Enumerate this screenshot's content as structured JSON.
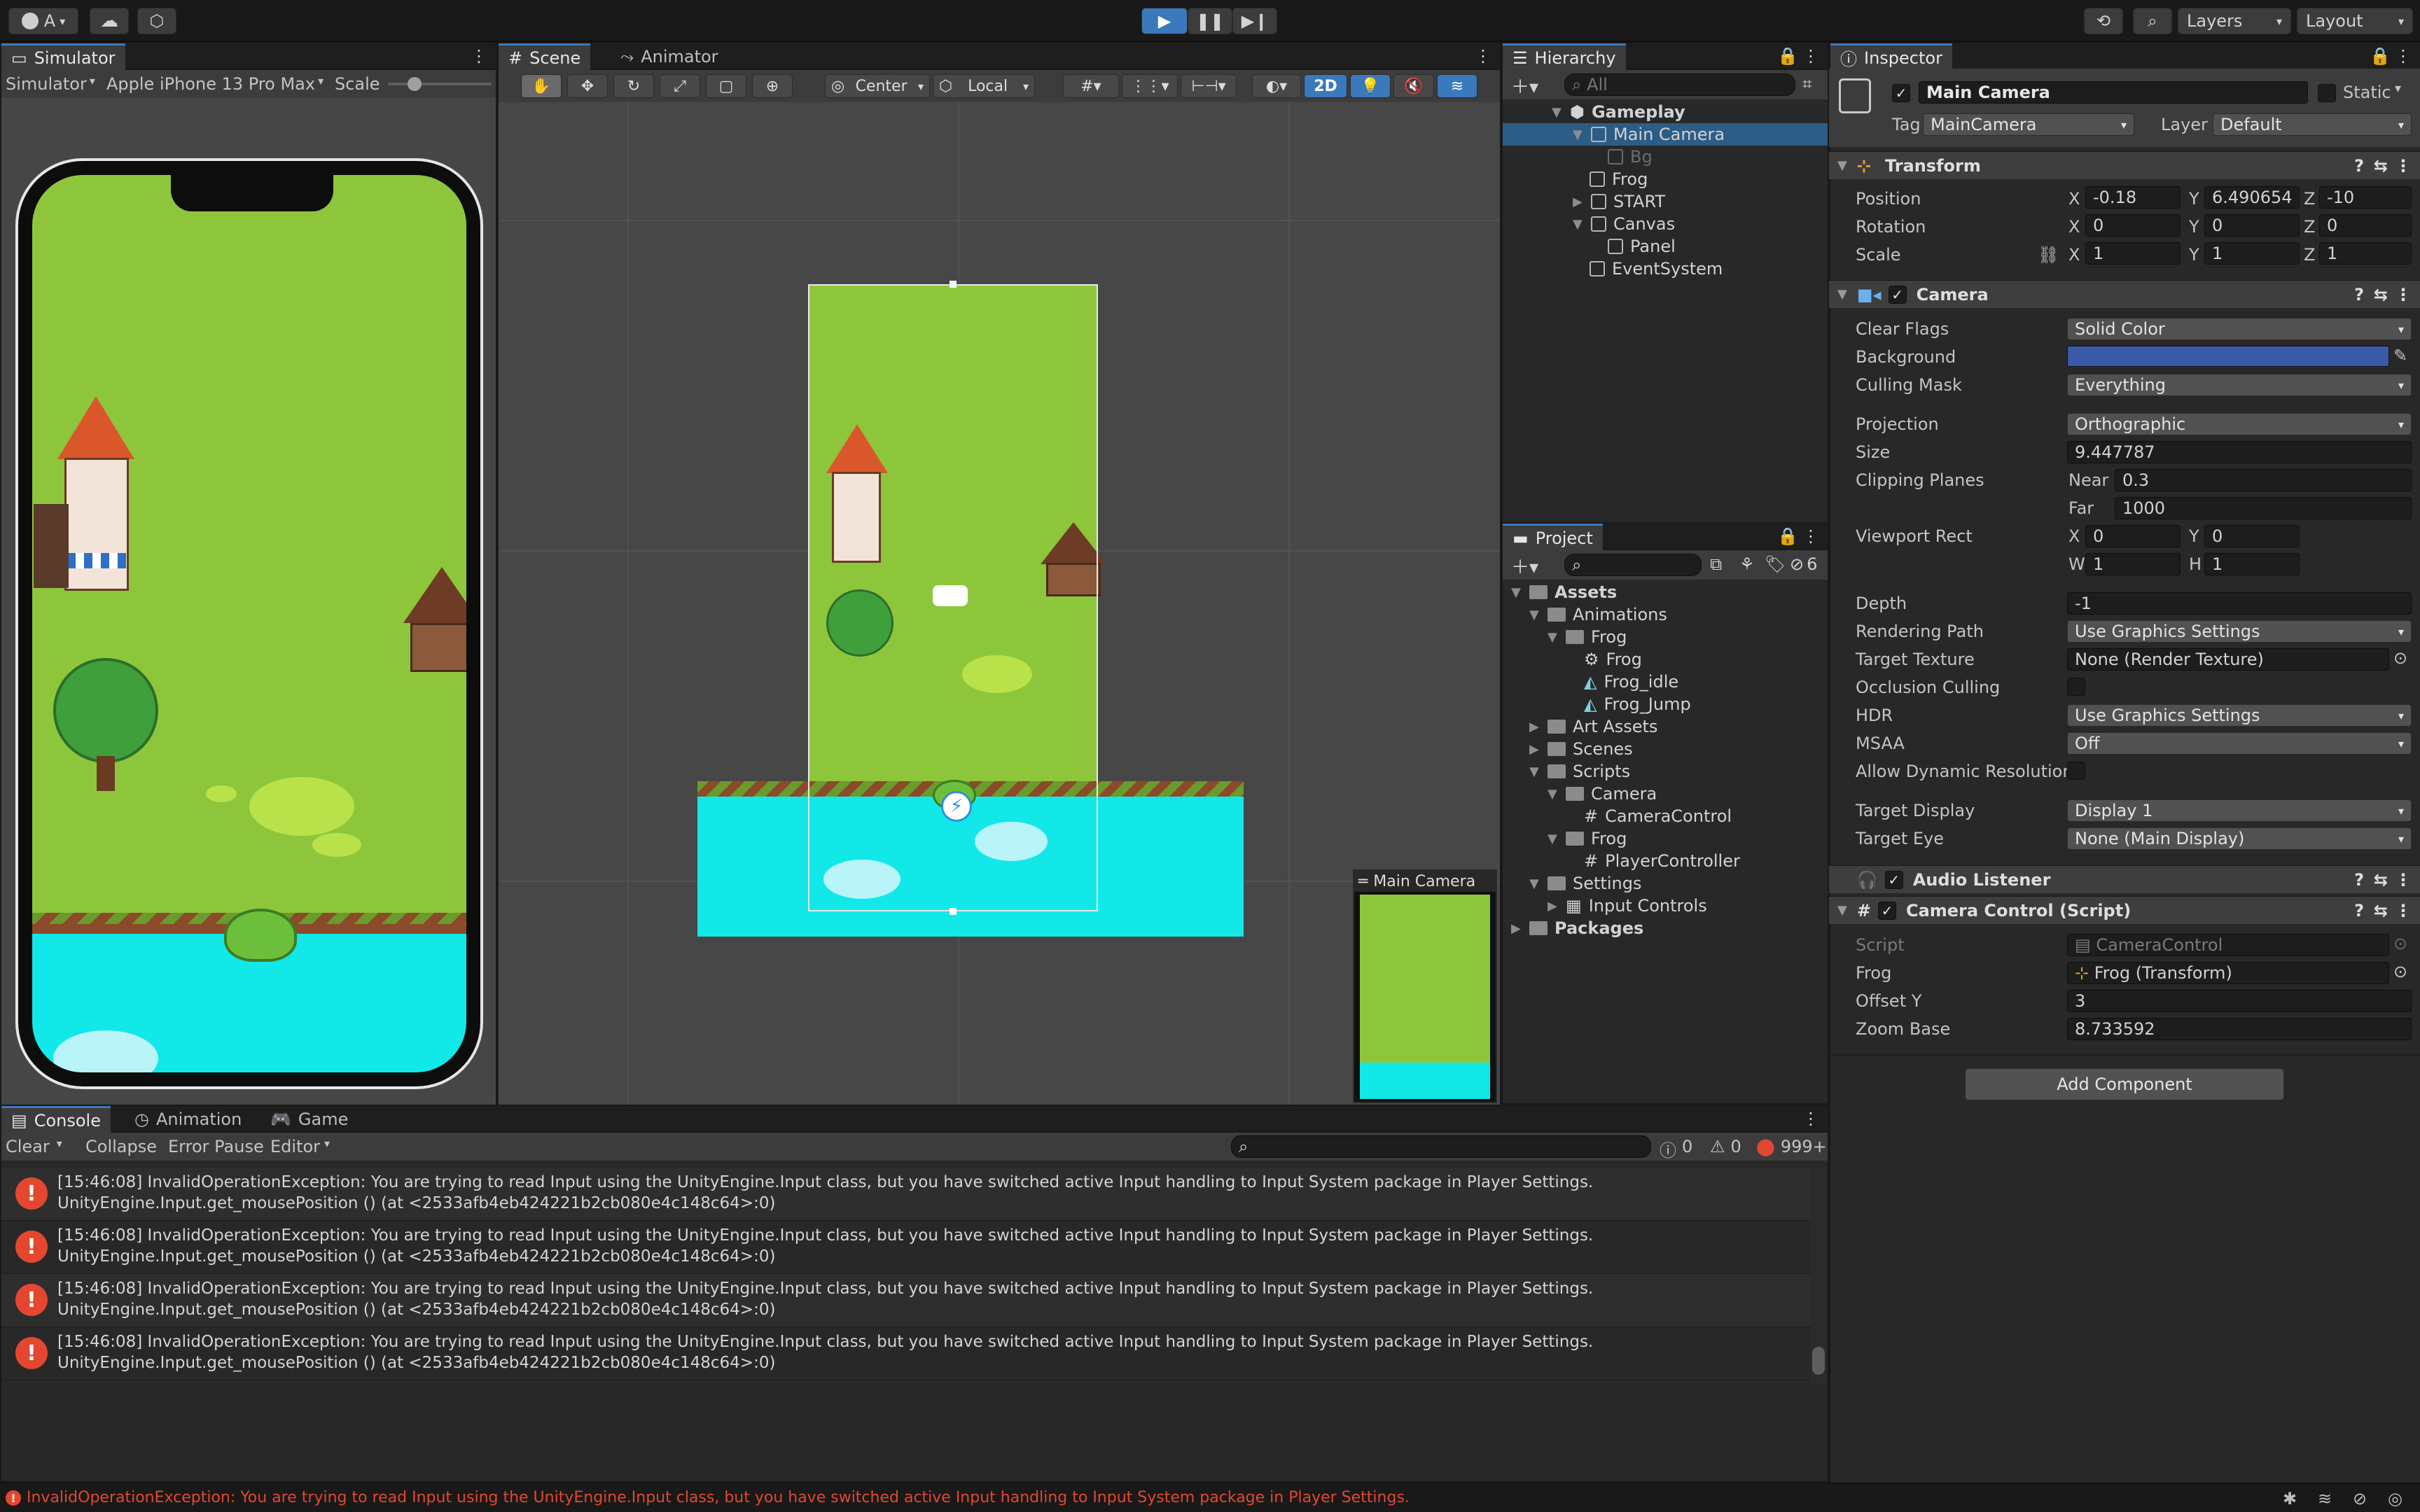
{
  "topbar": {
    "account": "A",
    "layers": "Layers",
    "layout": "Layout"
  },
  "simulator": {
    "tab": "Simulator",
    "mode": "Simulator",
    "device": "Apple iPhone 13 Pro Max",
    "scale_label": "Scale"
  },
  "scene_tabs": {
    "scene": "Scene",
    "animator": "Animator"
  },
  "scene_toolbar": {
    "pivot": "Center",
    "space": "Local",
    "two_d": "2D"
  },
  "camera_preview_title": "Main Camera",
  "hierarchy": {
    "tab": "Hierarchy",
    "search_placeholder": "All",
    "items": [
      "Gameplay",
      "Main Camera",
      "Bg",
      "Frog",
      "START",
      "Canvas",
      "Panel",
      "EventSystem"
    ]
  },
  "project": {
    "tab": "Project",
    "hidden_count": "6",
    "items": [
      "Assets",
      "Animations",
      "Frog",
      "Frog",
      "Frog_idle",
      "Frog_Jump",
      "Art Assets",
      "Scenes",
      "Scripts",
      "Camera",
      "CameraControl",
      "Frog",
      "PlayerController",
      "Settings",
      "Input Controls",
      "Packages"
    ]
  },
  "inspector": {
    "tab": "Inspector",
    "object_name": "Main Camera",
    "static_label": "Static",
    "tag_label": "Tag",
    "tag_value": "MainCamera",
    "layer_label": "Layer",
    "layer_value": "Default",
    "transform": {
      "title": "Transform",
      "position_label": "Position",
      "pos_x": "-0.18",
      "pos_y": "6.490654",
      "pos_z": "-10",
      "rotation_label": "Rotation",
      "rot_x": "0",
      "rot_y": "0",
      "rot_z": "0",
      "scale_label": "Scale",
      "scale_x": "1",
      "scale_y": "1",
      "scale_z": "1"
    },
    "camera": {
      "title": "Camera",
      "clear_flags_label": "Clear Flags",
      "clear_flags": "Solid Color",
      "background_label": "Background",
      "background_color": "#3a5aa8",
      "culling_mask_label": "Culling Mask",
      "culling_mask": "Everything",
      "projection_label": "Projection",
      "projection": "Orthographic",
      "size_label": "Size",
      "size": "9.447787",
      "clipping_label": "Clipping Planes",
      "near_label": "Near",
      "near": "0.3",
      "far_label": "Far",
      "far": "1000",
      "viewport_label": "Viewport Rect",
      "vx": "0",
      "vy": "0",
      "vw": "1",
      "vh": "1",
      "depth_label": "Depth",
      "depth": "-1",
      "rendering_path_label": "Rendering Path",
      "rendering_path": "Use Graphics Settings",
      "target_texture_label": "Target Texture",
      "target_texture": "None (Render Texture)",
      "occlusion_label": "Occlusion Culling",
      "hdr_label": "HDR",
      "hdr": "Use Graphics Settings",
      "msaa_label": "MSAA",
      "msaa": "Off",
      "dynamic_res_label": "Allow Dynamic Resolution",
      "target_display_label": "Target Display",
      "target_display": "Display 1",
      "target_eye_label": "Target Eye",
      "target_eye": "None (Main Display)"
    },
    "audio_listener": {
      "title": "Audio Listener"
    },
    "camera_control": {
      "title": "Camera Control (Script)",
      "script_label": "Script",
      "script": "CameraControl",
      "frog_label": "Frog",
      "frog": "Frog (Transform)",
      "offset_label": "Offset Y",
      "offset": "3",
      "zoom_label": "Zoom Base",
      "zoom": "8.733592"
    },
    "add_component": "Add Component"
  },
  "bottom_tabs": {
    "console": "Console",
    "animation": "Animation",
    "game": "Game"
  },
  "console_toolbar": {
    "clear": "Clear",
    "collapse": "Collapse",
    "error_pause": "Error Pause",
    "editor": "Editor",
    "log_count": "0",
    "warn_count": "0",
    "error_count": "999+"
  },
  "console_rows": [
    {
      "line1": "[15:46:08] InvalidOperationException: You are trying to read Input using the UnityEngine.Input class, but you have switched active Input handling to Input System package in Player Settings.",
      "line2": "UnityEngine.Input.get_mousePosition () (at <2533afb4eb424221b2cb080e4c148c64>:0)"
    },
    {
      "line1": "[15:46:08] InvalidOperationException: You are trying to read Input using the UnityEngine.Input class, but you have switched active Input handling to Input System package in Player Settings.",
      "line2": "UnityEngine.Input.get_mousePosition () (at <2533afb4eb424221b2cb080e4c148c64>:0)"
    },
    {
      "line1": "[15:46:08] InvalidOperationException: You are trying to read Input using the UnityEngine.Input class, but you have switched active Input handling to Input System package in Player Settings.",
      "line2": "UnityEngine.Input.get_mousePosition () (at <2533afb4eb424221b2cb080e4c148c64>:0)"
    },
    {
      "line1": "[15:46:08] InvalidOperationException: You are trying to read Input using the UnityEngine.Input class, but you have switched active Input handling to Input System package in Player Settings.",
      "line2": "UnityEngine.Input.get_mousePosition () (at <2533afb4eb424221b2cb080e4c148c64>:0)"
    }
  ],
  "status_bar": "InvalidOperationException: You are trying to read Input using the UnityEngine.Input class, but you have switched active Input handling to Input System package in Player Settings.",
  "colors": {
    "accent": "#3a79bb",
    "error": "#e4472f",
    "grass": "#8ec63b",
    "water": "#12e8e8"
  }
}
